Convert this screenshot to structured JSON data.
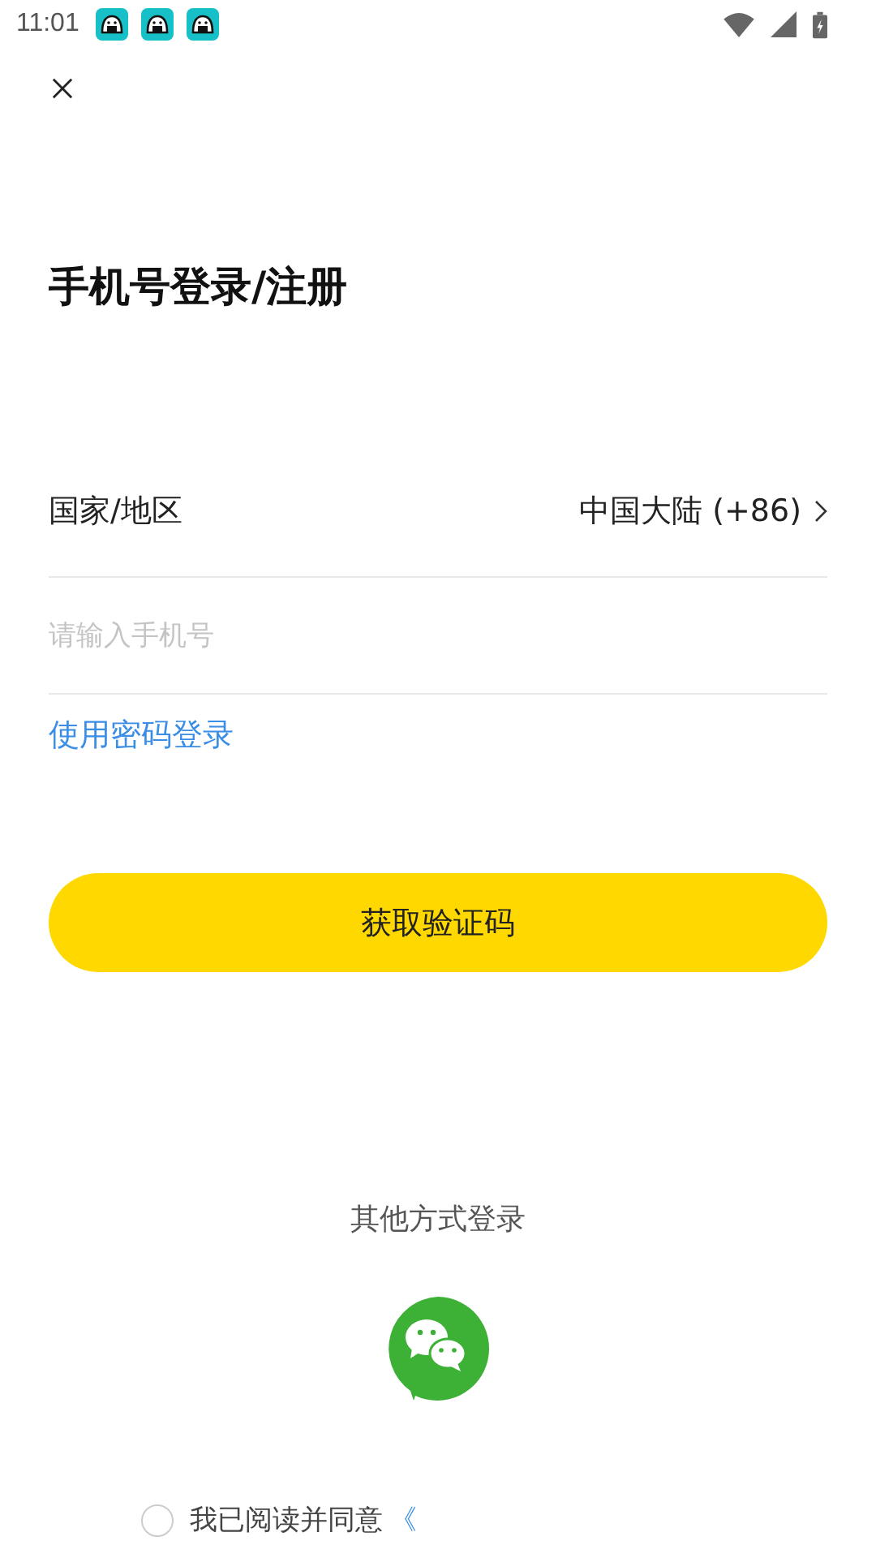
{
  "status_bar": {
    "time": "11:01"
  },
  "title": "手机号登录/注册",
  "region": {
    "label": "国家/地区",
    "value": "中国大陆 (+86)"
  },
  "phone": {
    "placeholder": "请输入手机号"
  },
  "password_login_link": "使用密码登录",
  "submit_button": "获取验证码",
  "other_login": {
    "label": "其他方式登录"
  },
  "agreement": {
    "checked": false,
    "text": "我已阅读并同意",
    "link": "《"
  }
}
